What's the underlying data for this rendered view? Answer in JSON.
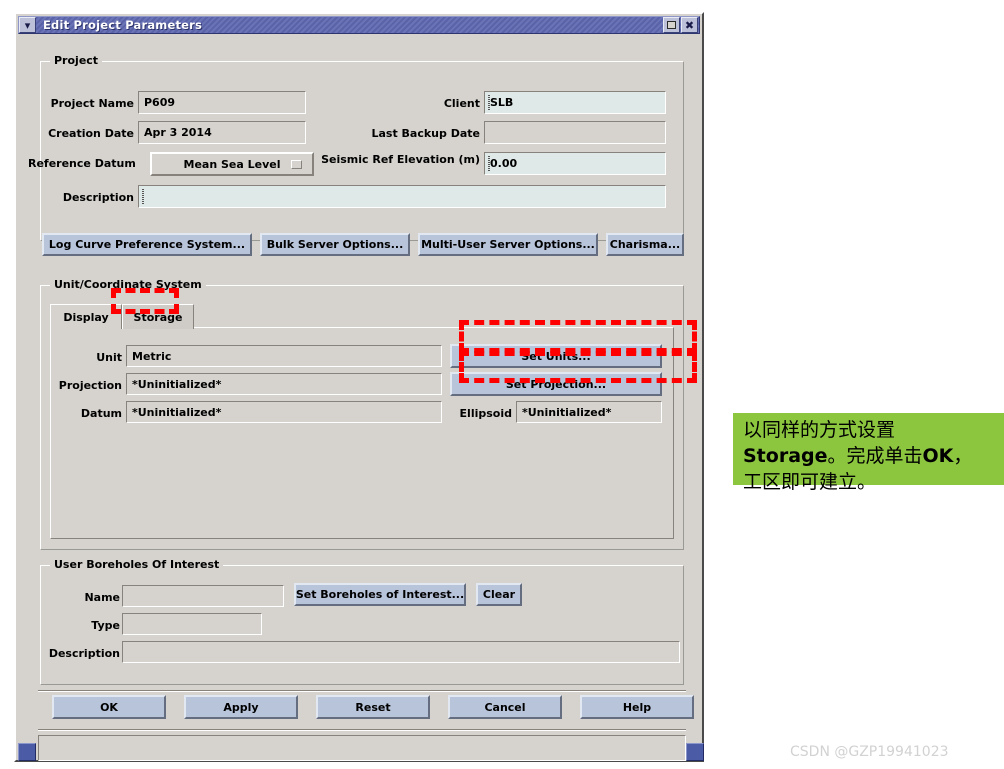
{
  "window": {
    "title": "Edit Project Parameters",
    "menu_icon": "window-menu-chevron-icon",
    "maximize_icon": "maximize-icon",
    "close_icon": "close-icon"
  },
  "project_group": {
    "title": "Project",
    "fields": {
      "project_name_label": "Project Name",
      "project_name_value": "P609",
      "creation_date_label": "Creation Date",
      "creation_date_value": "Apr 3 2014",
      "reference_datum_label": "Reference Datum",
      "reference_datum_value": "Mean Sea Level",
      "description_label": "Description",
      "description_value": "",
      "client_label": "Client",
      "client_value": "SLB",
      "last_backup_label": "Last Backup Date",
      "last_backup_value": "",
      "seismic_ref_label": "Seismic Ref Elevation (m)",
      "seismic_ref_value": "0.00"
    },
    "buttons": [
      "Log Curve Preference System...",
      "Bulk Server Options...",
      "Multi-User Server Options...",
      "Charisma..."
    ]
  },
  "unit_group": {
    "title": "Unit/Coordinate System",
    "tabs": [
      {
        "label": "Display",
        "selected": true
      },
      {
        "label": "Storage",
        "selected": false
      }
    ],
    "rows": {
      "unit_label": "Unit",
      "unit_value": "Metric",
      "projection_label": "Projection",
      "projection_value": "*Uninitialized*",
      "datum_label": "Datum",
      "datum_value": "*Uninitialized*",
      "ellipsoid_label": "Ellipsoid",
      "ellipsoid_value": "*Uninitialized*"
    },
    "buttons": {
      "set_units": "Set Units...",
      "set_projection": "Set Projection..."
    }
  },
  "borehole_group": {
    "title": "User Boreholes Of Interest",
    "name_label": "Name",
    "name_value": "",
    "type_label": "Type",
    "type_value": "",
    "description_label": "Description",
    "description_value": "",
    "set_boreholes_button": "Set Boreholes of Interest...",
    "clear_button": "Clear"
  },
  "action_buttons": [
    "OK",
    "Apply",
    "Reset",
    "Cancel",
    "Help"
  ],
  "status_bar": {
    "message": ""
  },
  "annotation": {
    "note_line1": "以同样的方式设置",
    "note_line2_bold_a": "Storage",
    "note_line2_rest": "。完成单击",
    "note_line2_bold_b": "OK",
    "note_line2_tail": "，",
    "note_line3": "工区即可建立。",
    "highlight_color": "#ff0000",
    "note_background": "#8cc63f"
  },
  "watermark": {
    "text": "CSDN @GZP19941023"
  }
}
